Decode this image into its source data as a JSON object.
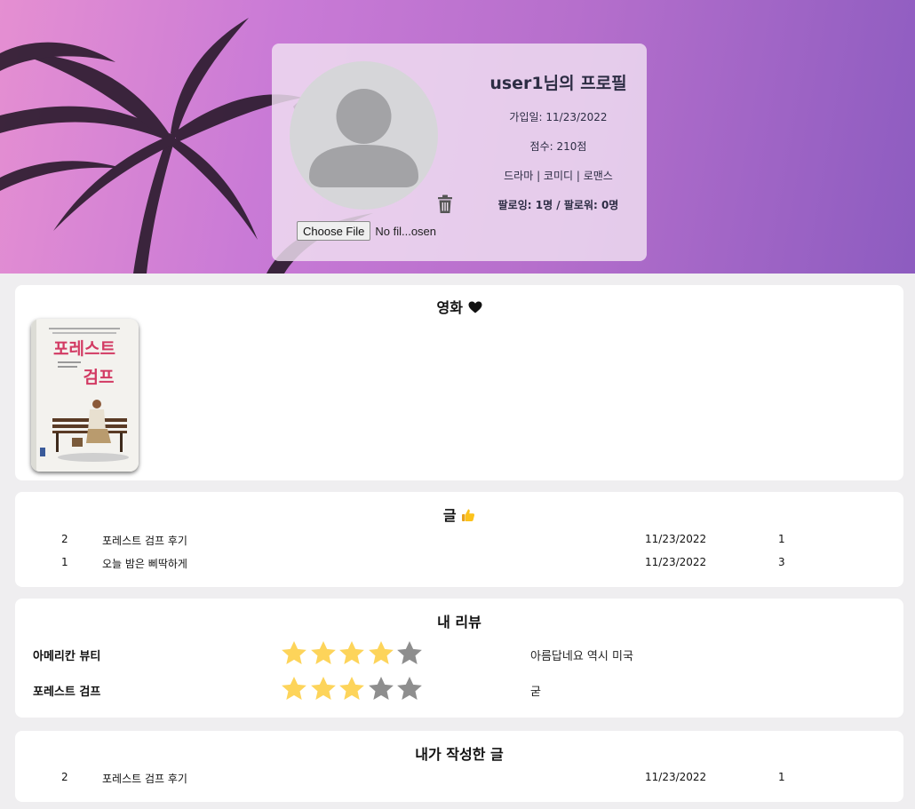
{
  "profile": {
    "title": "user1님의 프로필",
    "joined": "가입일: 11/23/2022",
    "score": "점수: 210점",
    "genres": "드라마 | 코미디 | 로맨스",
    "follow": "팔로잉: 1명 / 팔로워: 0명",
    "file_button": "Choose File",
    "file_status": "No fil...osen"
  },
  "movies": {
    "title": "영화",
    "title_icon": "heart-icon",
    "posters": [
      {
        "name": "forrest-gump-poster",
        "text": "포레스트 검프"
      }
    ]
  },
  "posts": {
    "title": "글",
    "title_icon": "thumbs-up-icon",
    "rows": [
      {
        "num": "2",
        "title": "포레스트 검프 후기",
        "date": "11/23/2022",
        "count": "1"
      },
      {
        "num": "1",
        "title": "오늘 밤은 삐딱하게",
        "date": "11/23/2022",
        "count": "3"
      }
    ]
  },
  "reviews": {
    "title": "내 리뷰",
    "items": [
      {
        "movie": "아메리칸 뷰티",
        "rating": 4,
        "max": 5,
        "comment": "아름답네요 역시 미국"
      },
      {
        "movie": "포레스트 검프",
        "rating": 3,
        "max": 5,
        "comment": "굳"
      }
    ]
  },
  "my_posts": {
    "title": "내가 작성한 글",
    "rows": [
      {
        "num": "2",
        "title": "포레스트 검프 후기",
        "date": "11/23/2022",
        "count": "1"
      }
    ]
  },
  "colors": {
    "star_on": "#fdd45a",
    "star_off": "#8e8e8e",
    "card_title": "#2d2d44"
  }
}
